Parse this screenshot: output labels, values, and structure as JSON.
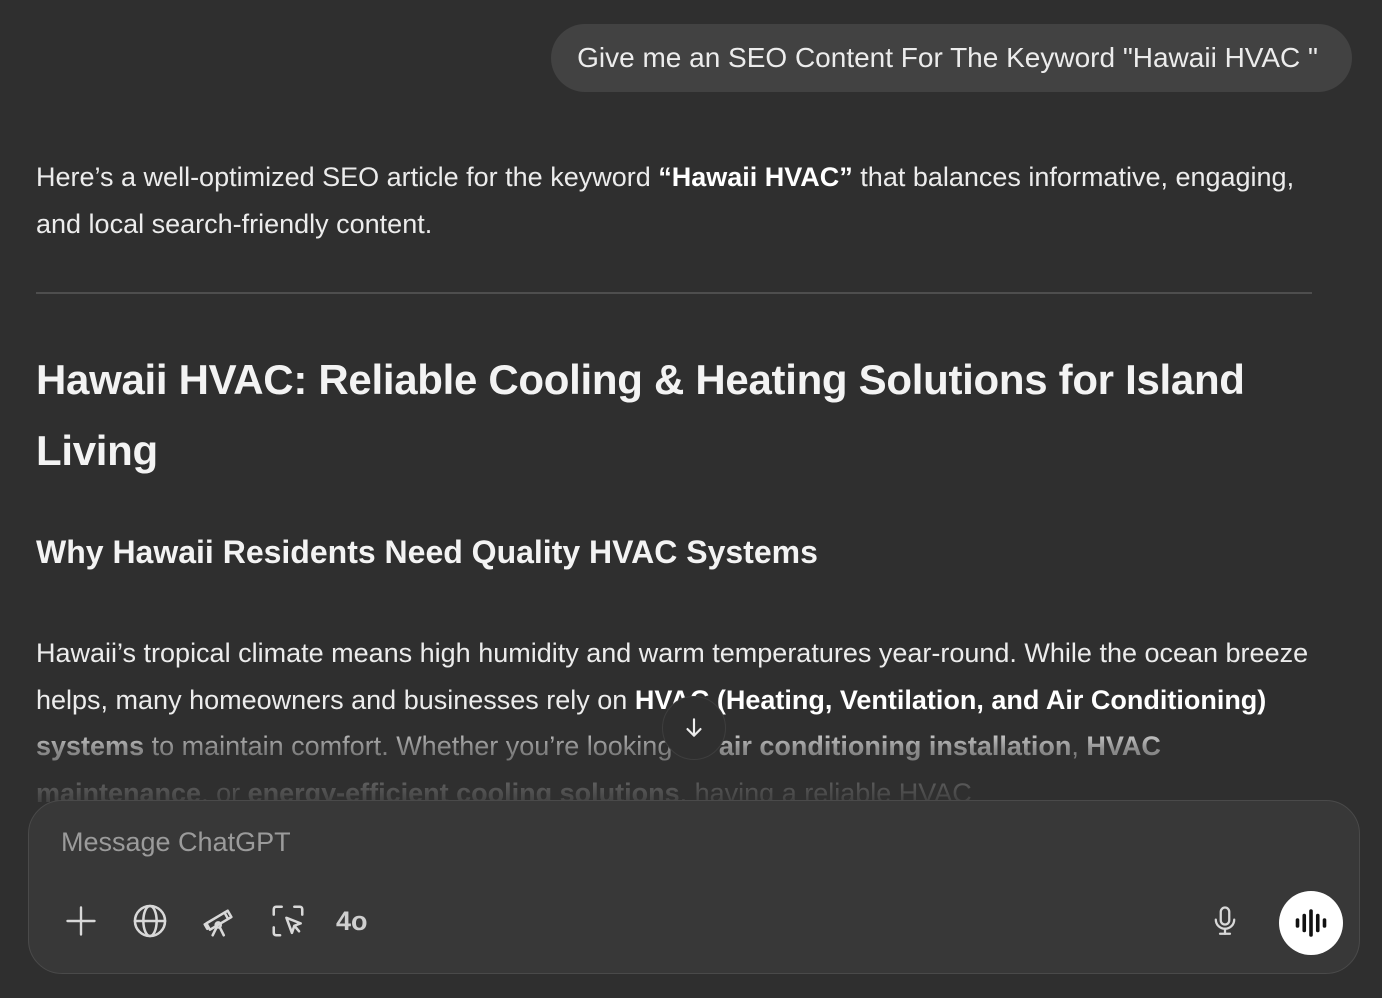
{
  "user_message": {
    "text": "Give me an SEO Content For The Keyword \"Hawaii HVAC \""
  },
  "assistant": {
    "intro": {
      "part1": "Here’s a well-optimized SEO article for the keyword ",
      "keyword": "“Hawaii HVAC”",
      "part2": " that balances informative, engaging, and local search-friendly content."
    },
    "title": "Hawaii HVAC: Reliable Cooling & Heating Solutions for Island Living",
    "section_heading": "Why Hawaii Residents Need Quality HVAC Systems",
    "paragraph": {
      "part1": "Hawaii’s tropical climate means high humidity and warm temperatures year-round. While the ocean breeze helps, many homeowners and businesses rely on ",
      "bold1": "HVAC (Heating, Ventilation, and Air Conditioning) systems",
      "part2": " to maintain comfort. Whether you’re looking for ",
      "bold2": "air conditioning installation",
      "part3": ", ",
      "bold3": "HVAC maintenance",
      "part4": ", or ",
      "bold4": "energy-efficient cooling solutions",
      "part5": ", having a reliable HVAC"
    }
  },
  "composer": {
    "placeholder": "Message ChatGPT",
    "model": "4o"
  },
  "icons": {
    "scroll": "arrow-down-icon",
    "attach": "plus-icon",
    "search": "globe-icon",
    "research": "telescope-icon",
    "canvas": "cursor-select-icon",
    "dictate": "microphone-icon",
    "voice": "voice-waveform-icon"
  }
}
